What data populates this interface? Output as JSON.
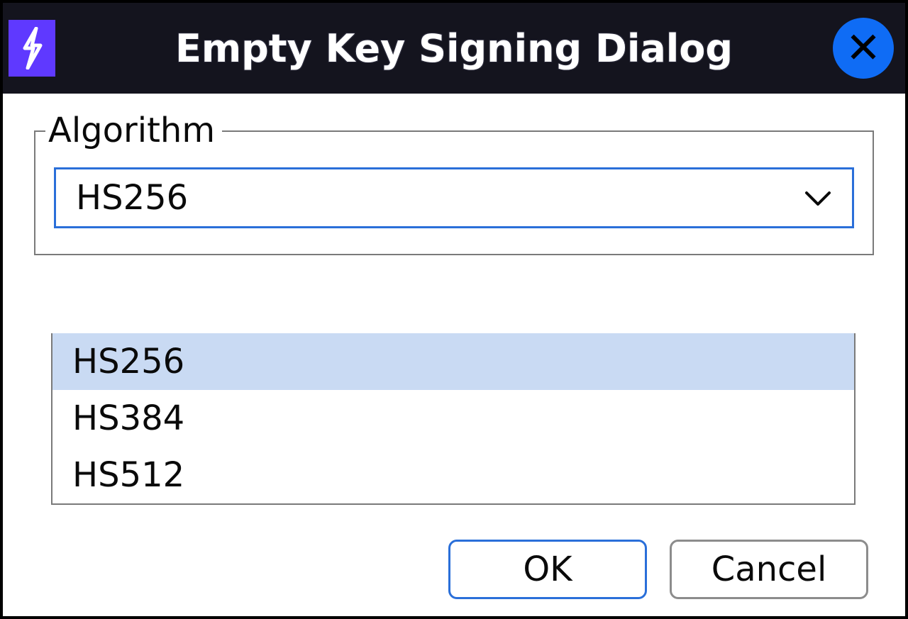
{
  "titlebar": {
    "title": "Empty Key Signing Dialog",
    "app_icon": "lightning-icon",
    "close_icon": "close-icon"
  },
  "fieldset": {
    "legend": "Algorithm"
  },
  "combo": {
    "selected": "HS256",
    "chevron_icon": "chevron-down-icon",
    "options": [
      "HS256",
      "HS384",
      "HS512"
    ],
    "highlighted_index": 0
  },
  "buttons": {
    "ok": "OK",
    "cancel": "Cancel"
  }
}
